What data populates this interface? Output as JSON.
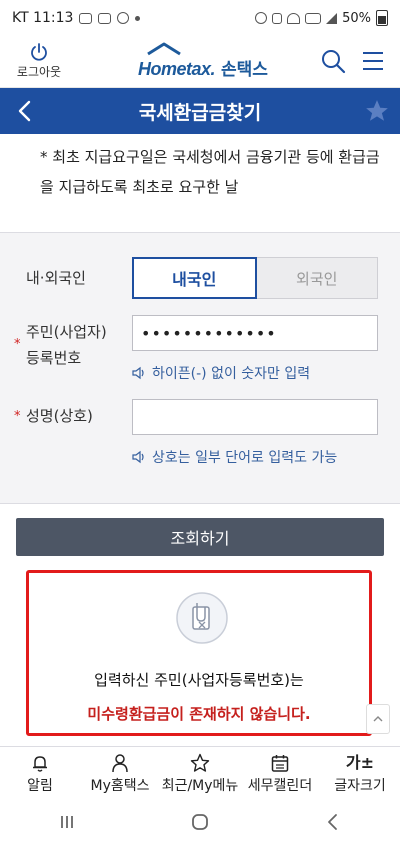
{
  "status_bar": {
    "carrier_time": "KT 11:13",
    "battery_text": "50%"
  },
  "header": {
    "logout_label": "로그아웃",
    "logo_text": "Hometax.",
    "logo_text_ko": "손택스"
  },
  "title_bar": {
    "title": "국세환급금찾기"
  },
  "notice": {
    "text": "* 최초 지급요구일은 국세청에서 금융기관 등에 환급금을 지급하도록 최초로 요구한 날"
  },
  "form": {
    "nationality_label": "내·외국인",
    "nationality_options": [
      "내국인",
      "외국인"
    ],
    "nationality_selected": "내국인",
    "id_label": "주민(사업자)등록번호",
    "id_label_line1": "주민(사업자)",
    "id_label_line2": "등록번호",
    "id_value": "•••••••••••••",
    "id_hint": "하이픈(-) 없이 숫자만 입력",
    "name_label": "성명(상호)",
    "name_value": "",
    "name_hint": "상호는 일부 단어로 입력도 가능",
    "required_mark": "*"
  },
  "search_button": "조회하기",
  "result": {
    "line1": "입력하신 주민(사업자등록번호)는",
    "line2": "미수령환급금이 존재하지 않습니다."
  },
  "bottom_nav": [
    {
      "label": "알림",
      "icon": "bell-icon"
    },
    {
      "label": "My홈택스",
      "icon": "person-icon"
    },
    {
      "label": "최근/My메뉴",
      "icon": "star-icon"
    },
    {
      "label": "세무캘린더",
      "icon": "calendar-icon"
    },
    {
      "label": "글자크기",
      "icon": "font-size-icon",
      "glyph": "가±"
    }
  ],
  "colors": {
    "primary": "#1e4fa0",
    "button": "#4d5665",
    "alert_border": "#e21b1b",
    "alert_text": "#c5201d"
  }
}
